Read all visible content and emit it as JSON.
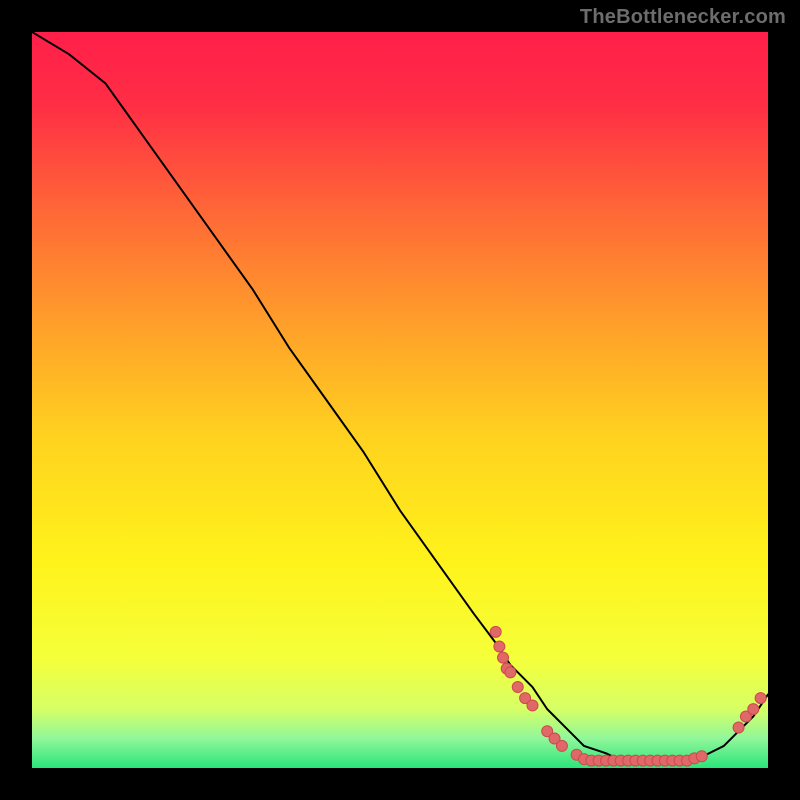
{
  "watermark": "TheBottlenecker.com",
  "chart_data": {
    "type": "line",
    "title": "",
    "xlabel": "",
    "ylabel": "",
    "xlim": [
      0,
      100
    ],
    "ylim": [
      0,
      100
    ],
    "grid": false,
    "x": [
      0,
      5,
      10,
      15,
      20,
      25,
      30,
      35,
      40,
      45,
      50,
      55,
      60,
      63,
      65,
      68,
      70,
      73,
      75,
      78,
      80,
      83,
      85,
      88,
      90,
      92,
      94,
      96,
      98,
      100
    ],
    "y": [
      100,
      97,
      93,
      86,
      79,
      72,
      65,
      57,
      50,
      43,
      35,
      28,
      21,
      17,
      14,
      11,
      8,
      5,
      3,
      2,
      1,
      1,
      1,
      1,
      1,
      2,
      3,
      5,
      7,
      10
    ],
    "scatter_points": [
      {
        "x": 63,
        "y": 18.5
      },
      {
        "x": 63.5,
        "y": 16.5
      },
      {
        "x": 64,
        "y": 15
      },
      {
        "x": 64.5,
        "y": 13.5
      },
      {
        "x": 65,
        "y": 13
      },
      {
        "x": 66,
        "y": 11
      },
      {
        "x": 67,
        "y": 9.5
      },
      {
        "x": 68,
        "y": 8.5
      },
      {
        "x": 70,
        "y": 5
      },
      {
        "x": 71,
        "y": 4
      },
      {
        "x": 72,
        "y": 3
      },
      {
        "x": 74,
        "y": 1.8
      },
      {
        "x": 75,
        "y": 1.2
      },
      {
        "x": 76,
        "y": 1
      },
      {
        "x": 77,
        "y": 1
      },
      {
        "x": 78,
        "y": 1
      },
      {
        "x": 79,
        "y": 1
      },
      {
        "x": 80,
        "y": 1
      },
      {
        "x": 81,
        "y": 1
      },
      {
        "x": 82,
        "y": 1
      },
      {
        "x": 83,
        "y": 1
      },
      {
        "x": 84,
        "y": 1
      },
      {
        "x": 85,
        "y": 1
      },
      {
        "x": 86,
        "y": 1
      },
      {
        "x": 87,
        "y": 1
      },
      {
        "x": 88,
        "y": 1
      },
      {
        "x": 89,
        "y": 1
      },
      {
        "x": 90,
        "y": 1.3
      },
      {
        "x": 91,
        "y": 1.6
      },
      {
        "x": 96,
        "y": 5.5
      },
      {
        "x": 97,
        "y": 7
      },
      {
        "x": 98,
        "y": 8
      },
      {
        "x": 99,
        "y": 9.5
      }
    ],
    "gradient_stops": [
      {
        "offset": 0.0,
        "color": "#ff1f4a"
      },
      {
        "offset": 0.1,
        "color": "#ff2e45"
      },
      {
        "offset": 0.25,
        "color": "#ff6a36"
      },
      {
        "offset": 0.4,
        "color": "#ffa02a"
      },
      {
        "offset": 0.55,
        "color": "#ffd21f"
      },
      {
        "offset": 0.72,
        "color": "#fff31b"
      },
      {
        "offset": 0.85,
        "color": "#f5ff3a"
      },
      {
        "offset": 0.92,
        "color": "#d6ff66"
      },
      {
        "offset": 0.96,
        "color": "#90f79a"
      },
      {
        "offset": 1.0,
        "color": "#2be47a"
      }
    ],
    "line_color": "#000000",
    "point_color": "#e06868",
    "point_stroke": "#cc4a4a"
  }
}
